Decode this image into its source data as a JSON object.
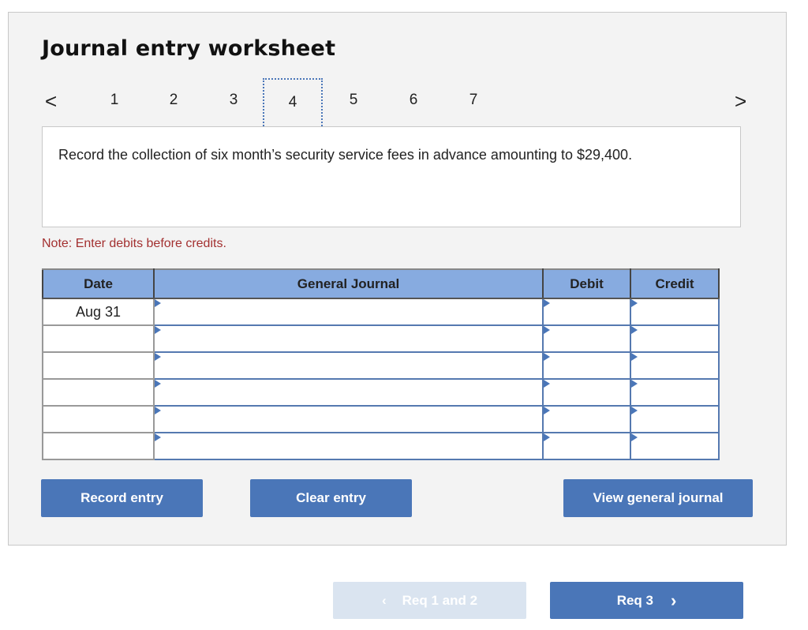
{
  "title": "Journal entry worksheet",
  "nav": {
    "prev": "<",
    "next": ">",
    "steps": [
      "1",
      "2",
      "3",
      "4",
      "5",
      "6",
      "7"
    ],
    "active": "4"
  },
  "prompt": "Record the collection of six month’s security service fees in advance amounting to $29,400.",
  "note": "Note: Enter debits before credits.",
  "table": {
    "headers": [
      "Date",
      "General Journal",
      "Debit",
      "Credit"
    ],
    "rows": [
      {
        "date": "Aug 31"
      },
      {
        "date": ""
      },
      {
        "date": ""
      },
      {
        "date": ""
      },
      {
        "date": ""
      },
      {
        "date": ""
      }
    ]
  },
  "buttons": {
    "record": "Record entry",
    "clear": "Clear entry",
    "view": "View general journal"
  },
  "footer": {
    "prev": "Req 1 and 2",
    "next": "Req 3",
    "prev_enabled": false
  },
  "colors": {
    "accent": "#4a76b8",
    "header": "#87abe0",
    "note": "#a33030",
    "disabled": "#dae4f0"
  }
}
